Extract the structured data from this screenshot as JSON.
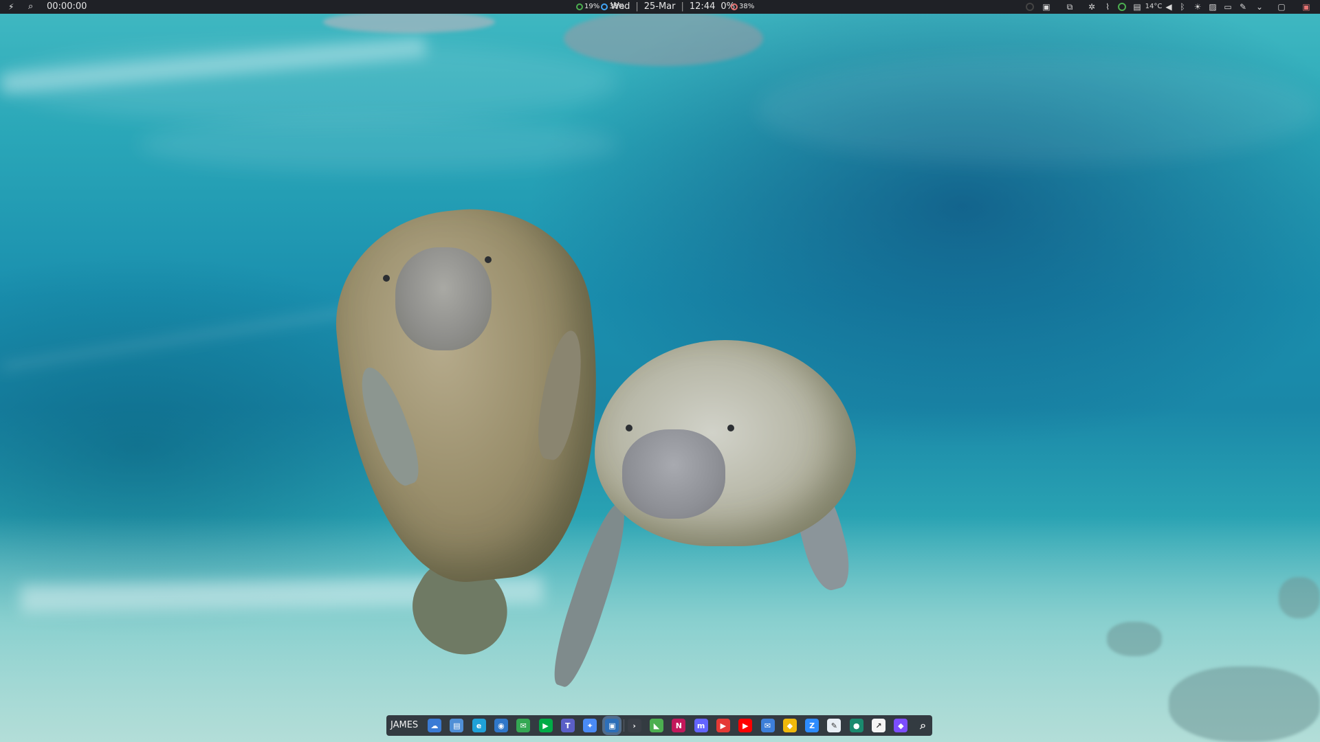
{
  "top_panel": {
    "timer": "00:00:00",
    "date_bar": {
      "cpu_percent": "19%",
      "mem_percent": "38%",
      "day": "Wed",
      "date": "25-Mar",
      "time": "12:44",
      "disk_percent": "0%",
      "battery_percent": "38%"
    },
    "weather_temp": "14°C",
    "tray_icons": [
      "system-monitor-icon",
      "screenshot-icon",
      "settings-icon",
      "network-icon",
      "vpn-icon",
      "clipboard-icon",
      "weather-icon",
      "volume-icon",
      "bluetooth-icon",
      "brightness-icon",
      "image-icon",
      "display-icon",
      "pen-icon",
      "chevron-down-icon",
      "window-icon",
      "desktop-icon"
    ]
  },
  "dock": {
    "user_label": "JAMES",
    "apps": [
      {
        "name": "nextcloud-icon",
        "color": "#3a7bd5",
        "glyph": "☁"
      },
      {
        "name": "file-manager-icon",
        "color": "#4f8fd6",
        "glyph": "▤"
      },
      {
        "name": "edge-browser-icon",
        "color": "#1fa1d8",
        "glyph": "e"
      },
      {
        "name": "chromium-icon",
        "color": "#2f77c9",
        "glyph": "◉"
      },
      {
        "name": "google-chat-icon",
        "color": "#34a853",
        "glyph": "✉"
      },
      {
        "name": "google-meet-icon",
        "color": "#00ac47",
        "glyph": "▶"
      },
      {
        "name": "teams-icon",
        "color": "#5b5fc7",
        "glyph": "T"
      },
      {
        "name": "gemini-icon",
        "color": "#4a8bf5",
        "glyph": "✦"
      },
      {
        "name": "screen-recorder-icon",
        "color": "#2d6fb8",
        "glyph": "▣"
      },
      {
        "name": "terminal-icon",
        "color": "#3a3f47",
        "glyph": "›"
      },
      {
        "name": "system-monitor-app-icon",
        "color": "#4caf50",
        "glyph": "◣"
      },
      {
        "name": "onenote-icon",
        "color": "#c2185b",
        "glyph": "N"
      },
      {
        "name": "mastodon-icon",
        "color": "#6364ff",
        "glyph": "m"
      },
      {
        "name": "video-player-icon",
        "color": "#e53935",
        "glyph": "▶"
      },
      {
        "name": "youtube-icon",
        "color": "#ff0000",
        "glyph": "▶"
      },
      {
        "name": "mail-icon",
        "color": "#3d7fd9",
        "glyph": "✉"
      },
      {
        "name": "binance-icon",
        "color": "#f0b90b",
        "glyph": "◆"
      },
      {
        "name": "zoom-icon",
        "color": "#2d8cff",
        "glyph": "Z"
      },
      {
        "name": "text-editor-icon",
        "color": "#e8eef5",
        "glyph": "✎"
      },
      {
        "name": "spotify-icon",
        "color": "#1a8a6e",
        "glyph": "●"
      },
      {
        "name": "stocks-icon",
        "color": "#f5f5f5",
        "glyph": "↗"
      },
      {
        "name": "obsidian-icon",
        "color": "#7c4dff",
        "glyph": "◆"
      },
      {
        "name": "search-icon",
        "color": "transparent",
        "glyph": "⌕"
      }
    ]
  }
}
